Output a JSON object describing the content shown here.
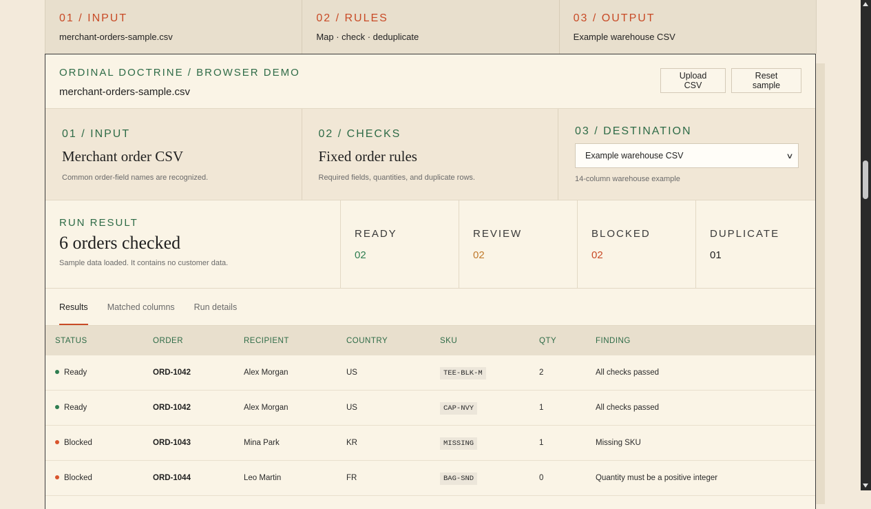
{
  "top_strip": [
    {
      "step": "01 / INPUT",
      "value": "merchant-orders-sample.csv"
    },
    {
      "step": "02 / RULES",
      "value": "Map · check · deduplicate"
    },
    {
      "step": "03 / OUTPUT",
      "value": "Example warehouse CSV"
    }
  ],
  "header": {
    "eyebrow": "ORDINAL DOCTRINE / BROWSER DEMO",
    "file_name": "merchant-orders-sample.csv",
    "upload_label": "Upload CSV",
    "reset_label": "Reset sample"
  },
  "steps": [
    {
      "num": "01 / INPUT",
      "title": "Merchant order CSV",
      "desc": "Common order-field names are recognized."
    },
    {
      "num": "02 / CHECKS",
      "title": "Fixed order rules",
      "desc": "Required fields, quantities, and duplicate rows."
    },
    {
      "num": "03 / DESTINATION",
      "selected": "Example warehouse CSV",
      "desc": "14-column warehouse example"
    }
  ],
  "run": {
    "label": "RUN RESULT",
    "title": "6 orders checked",
    "desc": "Sample data loaded. It contains no customer data."
  },
  "stats": [
    {
      "label": "READY",
      "value": "02",
      "color": "#2e7d50"
    },
    {
      "label": "REVIEW",
      "value": "02",
      "color": "#c07a2c"
    },
    {
      "label": "BLOCKED",
      "value": "02",
      "color": "#c84a26"
    },
    {
      "label": "DUPLICATE",
      "value": "01",
      "color": "#1f1f1f"
    }
  ],
  "tabs": [
    "Results",
    "Matched columns",
    "Run details"
  ],
  "table": {
    "headers": [
      "STATUS",
      "ORDER",
      "RECIPIENT",
      "COUNTRY",
      "SKU",
      "QTY",
      "FINDING"
    ],
    "rows": [
      {
        "status": "Ready",
        "order": "ORD-1042",
        "recipient": "Alex Morgan",
        "country": "US",
        "sku": "TEE-BLK-M",
        "qty": "2",
        "finding": "All checks passed"
      },
      {
        "status": "Ready",
        "order": "ORD-1042",
        "recipient": "Alex Morgan",
        "country": "US",
        "sku": "CAP-NVY",
        "qty": "1",
        "finding": "All checks passed"
      },
      {
        "status": "Blocked",
        "order": "ORD-1043",
        "recipient": "Mina Park",
        "country": "KR",
        "sku": "MISSING",
        "qty": "1",
        "finding": "Missing SKU"
      },
      {
        "status": "Blocked",
        "order": "ORD-1044",
        "recipient": "Leo Martin",
        "country": "FR",
        "sku": "BAG-SND",
        "qty": "0",
        "finding": "Quantity must be a positive integer"
      }
    ]
  }
}
